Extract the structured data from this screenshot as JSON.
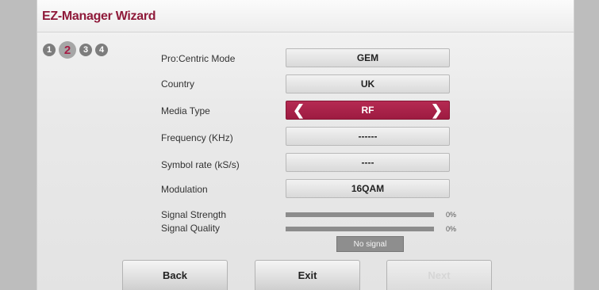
{
  "header": {
    "title": "EZ-Manager Wizard"
  },
  "steps": [
    "1",
    "2",
    "3",
    "4"
  ],
  "active_step": "2",
  "rows": [
    {
      "label": "Pro:Centric Mode",
      "value": "GEM"
    },
    {
      "label": "Country",
      "value": "UK"
    },
    {
      "label": "Media Type",
      "value": "RF"
    },
    {
      "label": "Frequency (KHz)",
      "value": "------"
    },
    {
      "label": "Symbol rate (kS/s)",
      "value": "----"
    },
    {
      "label": "Modulation",
      "value": "16QAM"
    }
  ],
  "signal": {
    "strength_label": "Signal Strength",
    "strength_value": "0%",
    "quality_label": "Signal Quality",
    "quality_value": "0%",
    "status": "No signal"
  },
  "buttons": {
    "back": "Back",
    "exit": "Exit",
    "next": "Next"
  },
  "colors": {
    "accent": "#a51d45",
    "title": "#8f1a3a"
  },
  "icons": {
    "prev": "chevron-left-icon",
    "next": "chevron-right-icon"
  }
}
